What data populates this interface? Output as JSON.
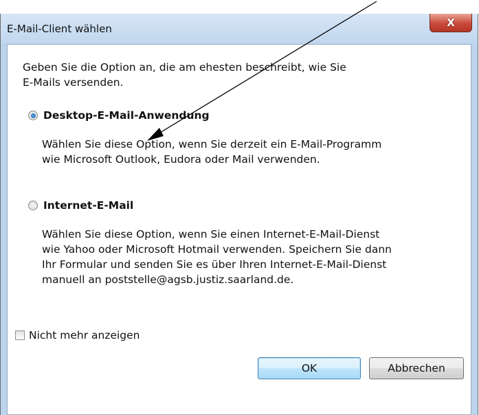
{
  "window": {
    "title": "E-Mail-Client wählen",
    "close_glyph": "X"
  },
  "intro": {
    "line1": "Geben Sie die Option an, die am ehesten beschreibt, wie Sie",
    "line2": "E-Mails versenden."
  },
  "options": [
    {
      "label": "Desktop-E-Mail-Anwendung",
      "selected": true,
      "description": [
        "Wählen Sie diese Option, wenn Sie derzeit ein E-Mail-Programm",
        "wie Microsoft Outlook, Eudora oder Mail verwenden."
      ]
    },
    {
      "label": "Internet-E-Mail",
      "selected": false,
      "description": [
        "Wählen Sie diese Option, wenn Sie einen Internet-E-Mail-Dienst",
        "wie Yahoo oder Microsoft Hotmail verwenden. Speichern Sie dann",
        "Ihr Formular und senden Sie es über Ihren Internet-E-Mail-Dienst",
        "manuell an poststelle@agsb.justiz.saarland.de."
      ]
    }
  ],
  "checkbox": {
    "label": "Nicht mehr anzeigen",
    "checked": false
  },
  "buttons": {
    "ok": "OK",
    "cancel": "Abbrechen"
  },
  "colors": {
    "frame": "#bcd3ec",
    "close_button": "#c9493a",
    "default_button_border": "#3c7fb1"
  },
  "icons": {
    "close": "close-icon",
    "arrow": "arrow-annotation"
  }
}
